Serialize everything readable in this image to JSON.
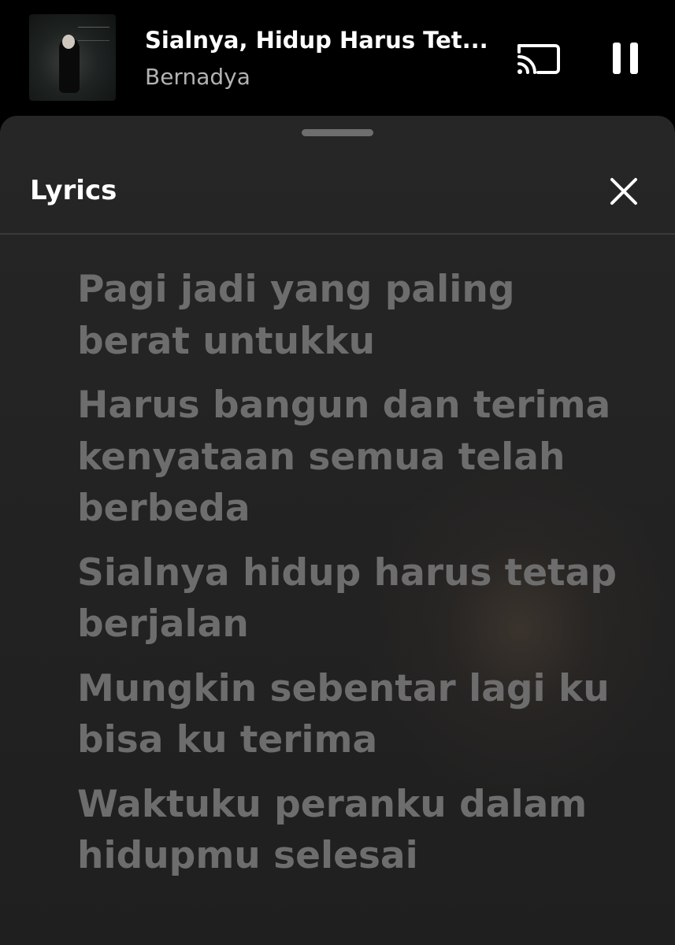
{
  "now_playing": {
    "title": "Sialnya, Hidup Harus Tet...",
    "artist": "Bernadya",
    "album_art_icon": "album-cover-image"
  },
  "controls": {
    "cast_icon": "cast-icon",
    "pause_icon": "pause-icon"
  },
  "lyrics_panel": {
    "title": "Lyrics",
    "close_icon": "close-icon",
    "lines": [
      [
        "Pagi jadi yang paling",
        "berat untukku"
      ],
      [
        "Harus bangun dan terima",
        "kenyataan semua telah",
        "berbeda"
      ],
      [
        "Sialnya hidup harus tetap",
        "berjalan"
      ],
      [
        "Mungkin sebentar lagi ku",
        "bisa ku terima"
      ],
      [
        "Waktuku peranku dalam",
        "hidupmu selesai"
      ]
    ]
  },
  "colors": {
    "background": "#000000",
    "sheet": "#242424",
    "lyric_text": "#6d6d6d",
    "artist_text": "#b3b3b3",
    "divider": "#3a3a3a"
  }
}
